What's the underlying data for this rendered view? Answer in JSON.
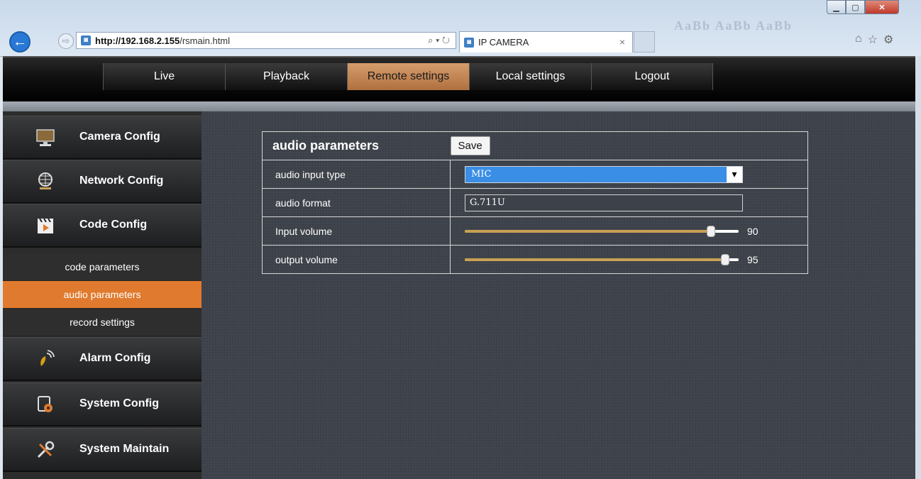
{
  "browser": {
    "url_host": "http://192.168.2.155",
    "url_path": "/rsmain.html",
    "tab_title": "IP CAMERA",
    "search_tools": "⌕ ▾ ↻"
  },
  "topnav": {
    "items": [
      "Live",
      "Playback",
      "Remote settings",
      "Local settings",
      "Logout"
    ],
    "active": "Remote settings"
  },
  "sidebar": {
    "items": [
      "Camera Config",
      "Network Config",
      "Code Config",
      "Alarm Config",
      "System Config",
      "System Maintain"
    ],
    "subitems": [
      "code parameters",
      "audio parameters",
      "record settings"
    ],
    "active_sub": "audio parameters"
  },
  "panel": {
    "title": "audio parameters",
    "save_label": "Save",
    "rows": {
      "input_type": {
        "label": "audio input type",
        "value": "MIC"
      },
      "format": {
        "label": "audio format",
        "value": "G.711U"
      },
      "input_volume": {
        "label": "Input volume",
        "value": 90
      },
      "output_volume": {
        "label": "output volume",
        "value": 95
      }
    }
  },
  "colors": {
    "accent": "#e07a2e",
    "active_tab": "#c88752",
    "select_bg": "#3a8ee6",
    "slider_fill": "#c8a155"
  }
}
